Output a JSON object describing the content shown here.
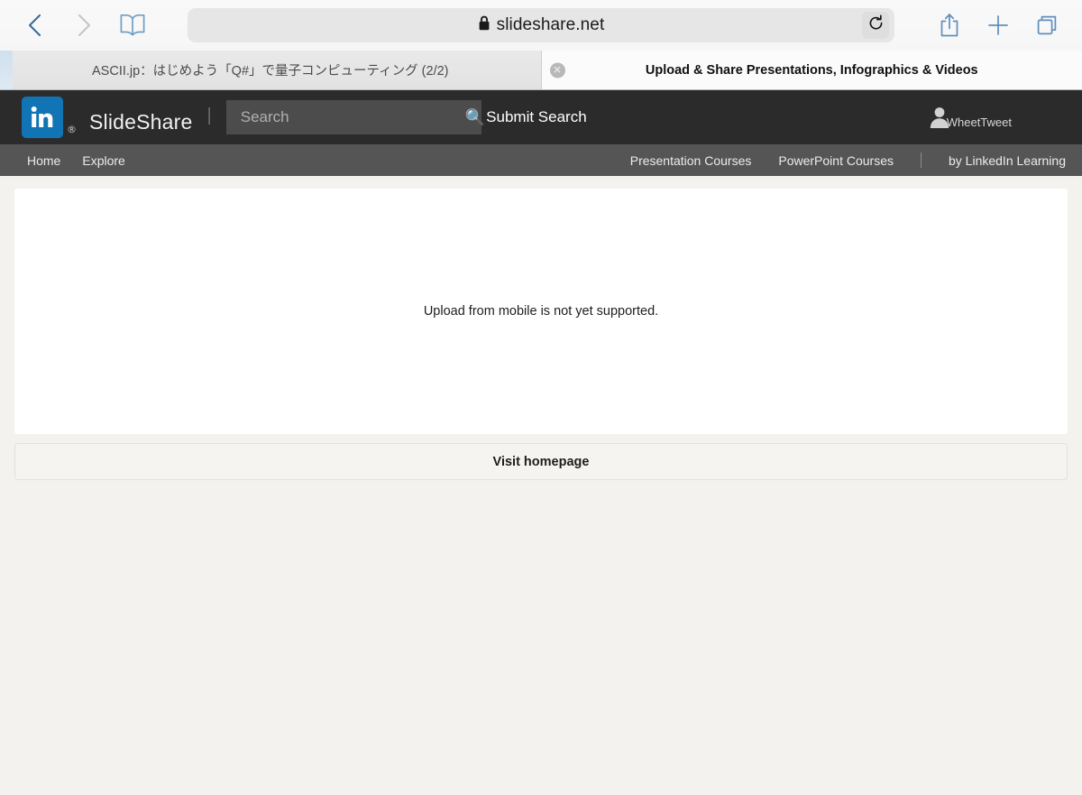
{
  "browser": {
    "back_icon": "chevron-left-icon",
    "forward_icon": "chevron-right-icon",
    "bookmarks_icon": "book-icon",
    "lock_icon": "lock-icon",
    "url": "slideshare.net",
    "reload_icon": "reload-icon",
    "share_icon": "share-icon",
    "new_tab_icon": "plus-icon",
    "tabs_icon": "tabs-overview-icon",
    "tabs": [
      {
        "title": "ASCII.jp：はじめよう「Q#」で量子コンピューティング (2/2)",
        "active": false,
        "close_label": "✕"
      },
      {
        "title": "Upload & Share Presentations, Infographics & Videos",
        "active": true,
        "close_label": "✕"
      }
    ]
  },
  "site": {
    "header": {
      "logo_icon": "linkedin-logo-icon",
      "logo_color": "#1074b5",
      "registered_mark": "®",
      "brand_name": "SlideShare",
      "separator": "|",
      "search": {
        "placeholder": "Search",
        "value": "",
        "submit_icon": "search-icon",
        "submit_label": "Submit Search"
      },
      "user": {
        "avatar_icon": "person-avatar-icon",
        "name": "WheetTweet"
      }
    },
    "nav": {
      "left_links": [
        {
          "label": "Home"
        },
        {
          "label": "Explore"
        }
      ],
      "right_links": [
        {
          "label": "Presentation Courses"
        },
        {
          "label": "PowerPoint Courses"
        }
      ],
      "learning_label": "by LinkedIn Learning"
    },
    "content": {
      "message": "Upload from mobile is not yet supported.",
      "homepage_button_label": "Visit homepage"
    }
  },
  "colors": {
    "header_bg": "#2b2b2b",
    "nav_bg": "#555555",
    "page_bg": "#f3f2ee",
    "card_bg": "#ffffff",
    "linkedin_blue": "#1074b5"
  }
}
